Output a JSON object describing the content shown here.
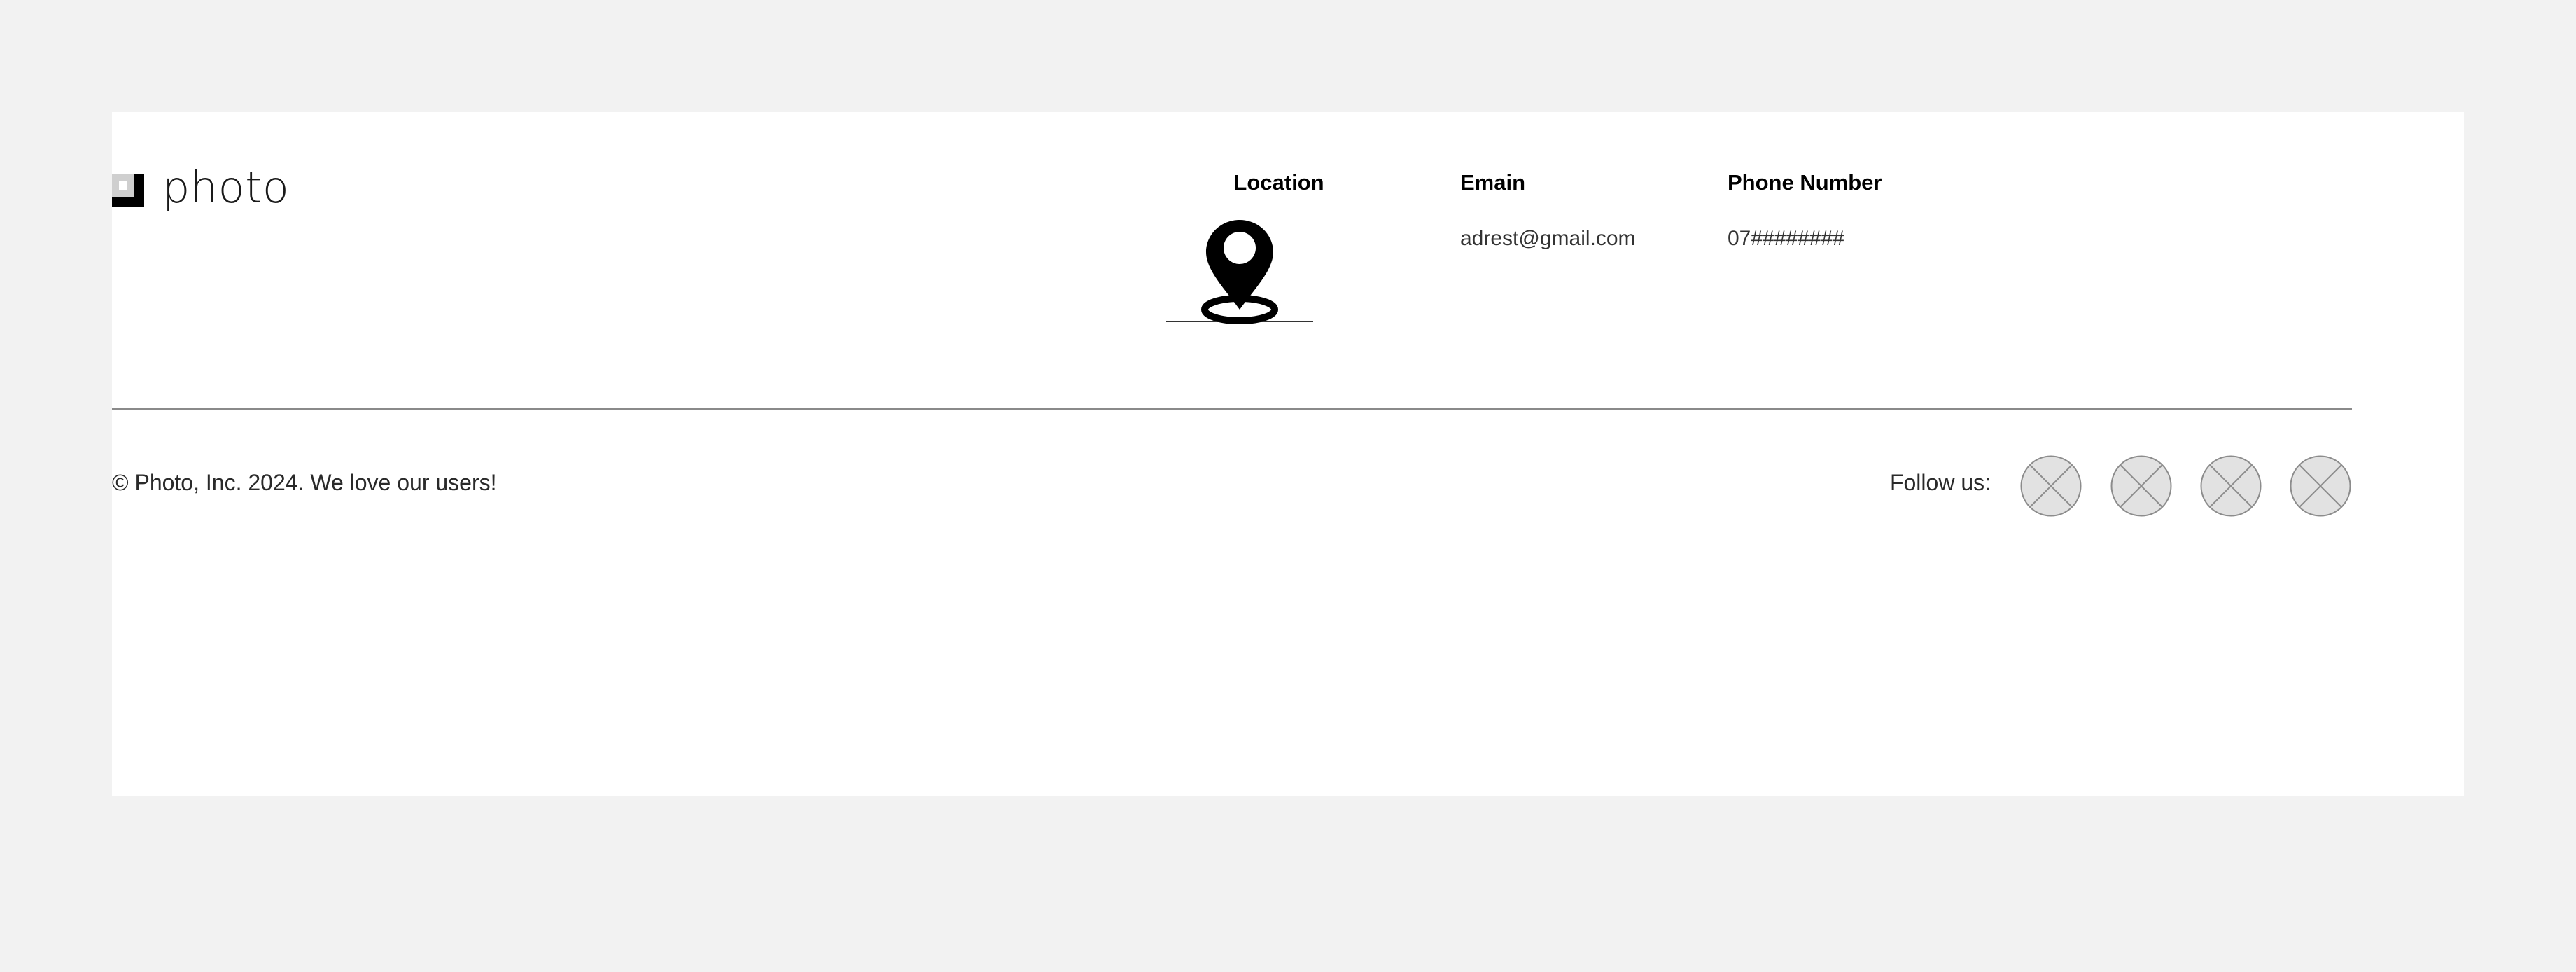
{
  "brand": {
    "name": "photo",
    "logo_icon": "photo-logo-square-icon"
  },
  "contact": {
    "location": {
      "heading": "Location",
      "icon": "map-pin-icon"
    },
    "email": {
      "heading": "Emain",
      "value": "adrest@gmail.com"
    },
    "phone": {
      "heading": "Phone Number",
      "value": "07########"
    }
  },
  "bottom_bar": {
    "copyright": "© Photo, Inc. 2024. We love our users!",
    "follow_label": "Follow us:",
    "social_links": [
      {
        "icon": "placeholder-image-icon"
      },
      {
        "icon": "placeholder-image-icon"
      },
      {
        "icon": "placeholder-image-icon"
      },
      {
        "icon": "placeholder-image-icon"
      }
    ]
  },
  "colors": {
    "page_background": "#f2f2f2",
    "card_background": "#ffffff",
    "text": "#222222",
    "heading": "#000000",
    "divider": "#8a8a8a",
    "placeholder_fill": "#e2e2e2",
    "placeholder_stroke": "#8c8c8c"
  }
}
